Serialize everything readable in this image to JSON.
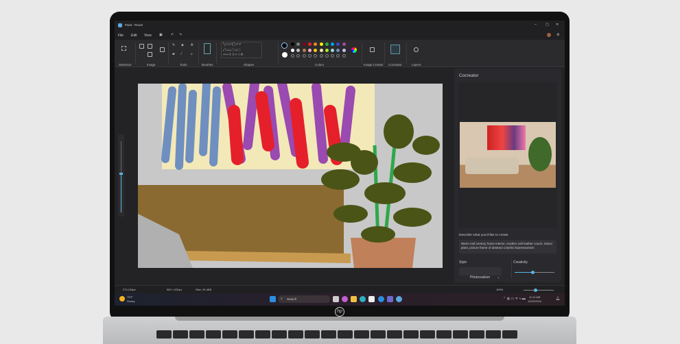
{
  "window": {
    "title": "Paint - Room"
  },
  "menu": [
    "File",
    "Edit",
    "View"
  ],
  "ribbon": {
    "groups": [
      "Selection",
      "Image",
      "Tools",
      "Brushes",
      "Shapes",
      "Colors",
      "Image Creator",
      "Cocreator",
      "Layers"
    ]
  },
  "colors": {
    "primary": "#000000",
    "secondary": "#ffffff",
    "palette_row1": [
      "#000000",
      "#7f7f7f",
      "#880015",
      "#ed1c24",
      "#ff7f27",
      "#fff200",
      "#22b14c",
      "#00a2e8",
      "#3f48cc",
      "#a349a4"
    ],
    "palette_row2": [
      "#ffffff",
      "#c3c3c3",
      "#b97a57",
      "#ffaec9",
      "#ffc90e",
      "#efe4b0",
      "#b5e61d",
      "#99d9ea",
      "#7092be",
      "#c8bfe7"
    ]
  },
  "cocreator": {
    "title": "Cocreator",
    "prompt_label": "Describe what you'd like to create",
    "prompt": "Warm mid century home interior, modern soft leather couch, indoor plant, picture frame of abstract colorful impressionism",
    "style_label": "Style",
    "style_value": "Photorealism",
    "creativity_label": "Creativity",
    "creativity_level": 0.45
  },
  "status": {
    "cursor": "274,134px",
    "dimensions": "962 × 631px",
    "size": "Size: 20.4KB",
    "zoom": "100%",
    "zoom_level": 0.4
  },
  "taskbar": {
    "temp": "79°F",
    "weather": "Sunny",
    "search_placeholder": "Search",
    "time": "11:11 AM",
    "date": "10/22/2024"
  },
  "laptop": {
    "brand": "hp"
  }
}
